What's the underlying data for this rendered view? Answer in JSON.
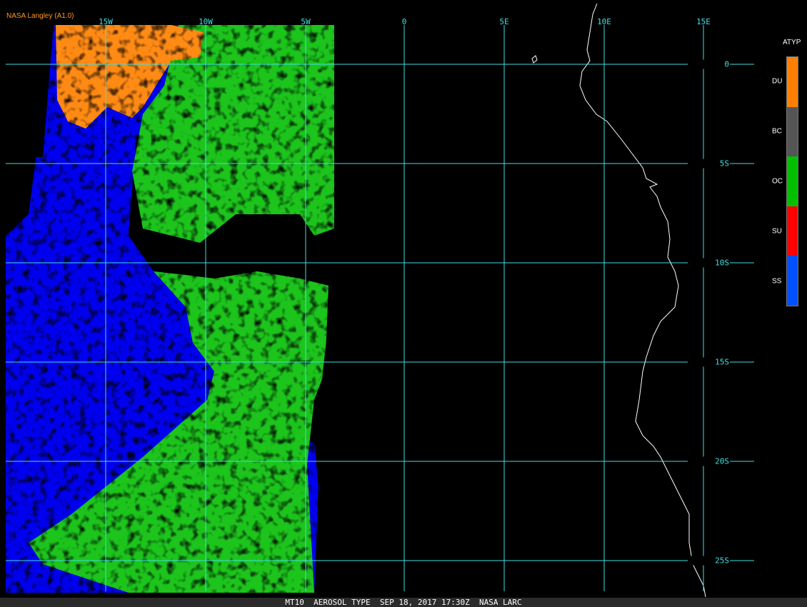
{
  "credit": "NASA Langley (A1.0)",
  "longitude_labels": [
    "15W",
    "10W",
    "5W",
    "0",
    "5E",
    "10E",
    "15E"
  ],
  "latitude_labels": [
    "0",
    "5S",
    "10S",
    "15S",
    "20S",
    "25S"
  ],
  "legend": {
    "title": "ATYP",
    "items": [
      {
        "label": "DU",
        "color": "#ff8000"
      },
      {
        "label": "BC",
        "color": "#555555"
      },
      {
        "label": "OC",
        "color": "#00c000"
      },
      {
        "label": "SU",
        "color": "#ff0000"
      },
      {
        "label": "SS",
        "color": "#0050ff"
      }
    ]
  },
  "colors": {
    "ss_field": "#0000ee",
    "oc_field": "#1cc41c",
    "du_field": "#ff8a14",
    "grid": "#3fe0e0",
    "coast": "#ffffff"
  },
  "footer": "MT10  AEROSOL TYPE  SEP 18, 2017 17:30Z  NASA LARC"
}
